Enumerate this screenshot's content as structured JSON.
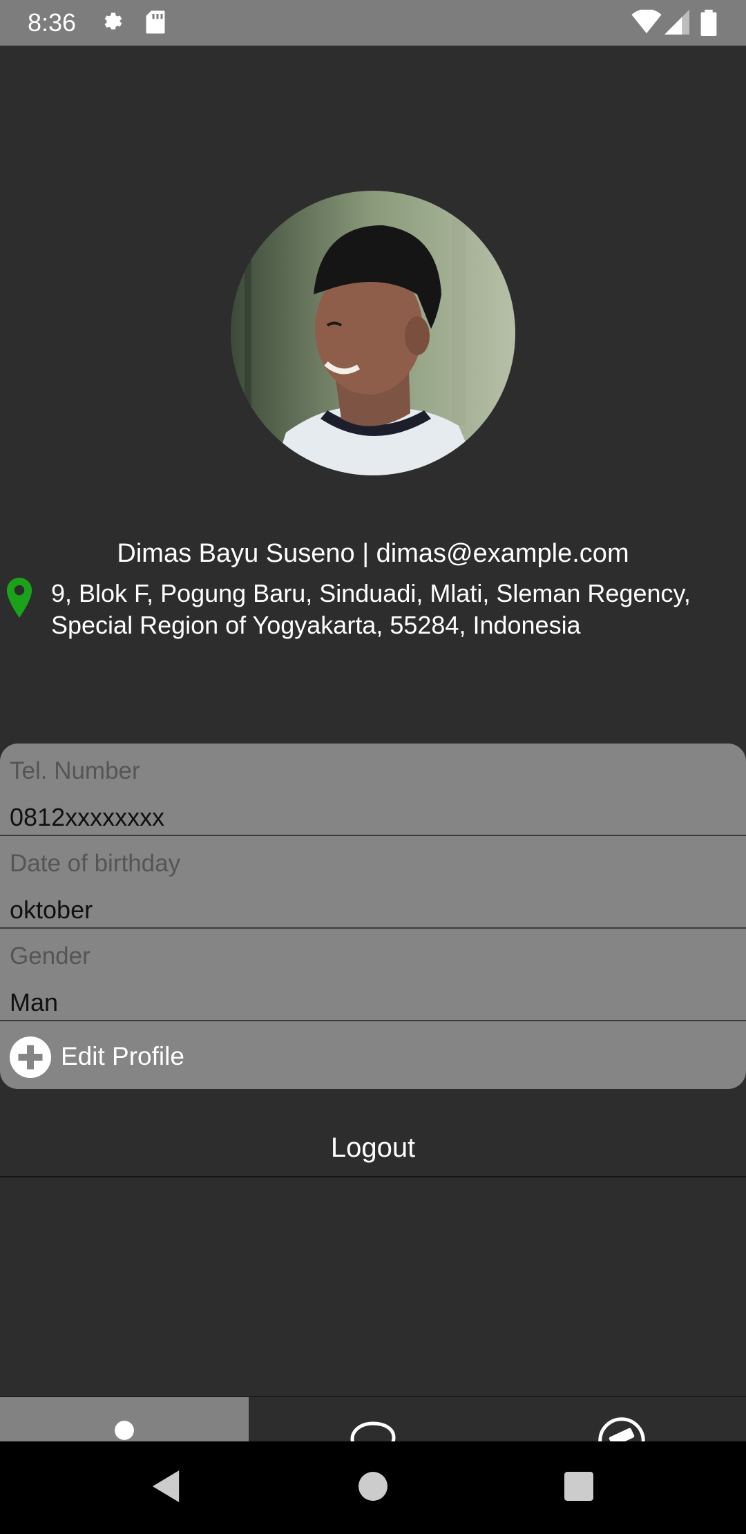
{
  "status_bar": {
    "time": "8:36",
    "icons": [
      "settings-icon",
      "sd-card-icon",
      "wifi-icon",
      "signal-icon",
      "battery-icon"
    ]
  },
  "profile": {
    "name_line": "Dimas Bayu Suseno | dimas@example.com",
    "address": "9, Blok F, Pogung Baru, Sinduadi, Mlati, Sleman Regency, Special Region of Yogyakarta, 55284, Indonesia",
    "avatar_icon": "person-photo"
  },
  "fields": [
    {
      "label": "Tel. Number",
      "value": "0812xxxxxxxx"
    },
    {
      "label": "Date of birthday",
      "value": "oktober"
    },
    {
      "label": "Gender",
      "value": "Man"
    }
  ],
  "edit_profile_label": "Edit Profile",
  "logout_label": "Logout",
  "bottom_nav": [
    "profile-icon",
    "chat-icon",
    "telescope-icon"
  ],
  "colors": {
    "background": "#2e2d2d",
    "card": "#858585",
    "status_bar": "#7d7d7d",
    "pin": "#1aa31a",
    "active_tab": "#828282"
  }
}
